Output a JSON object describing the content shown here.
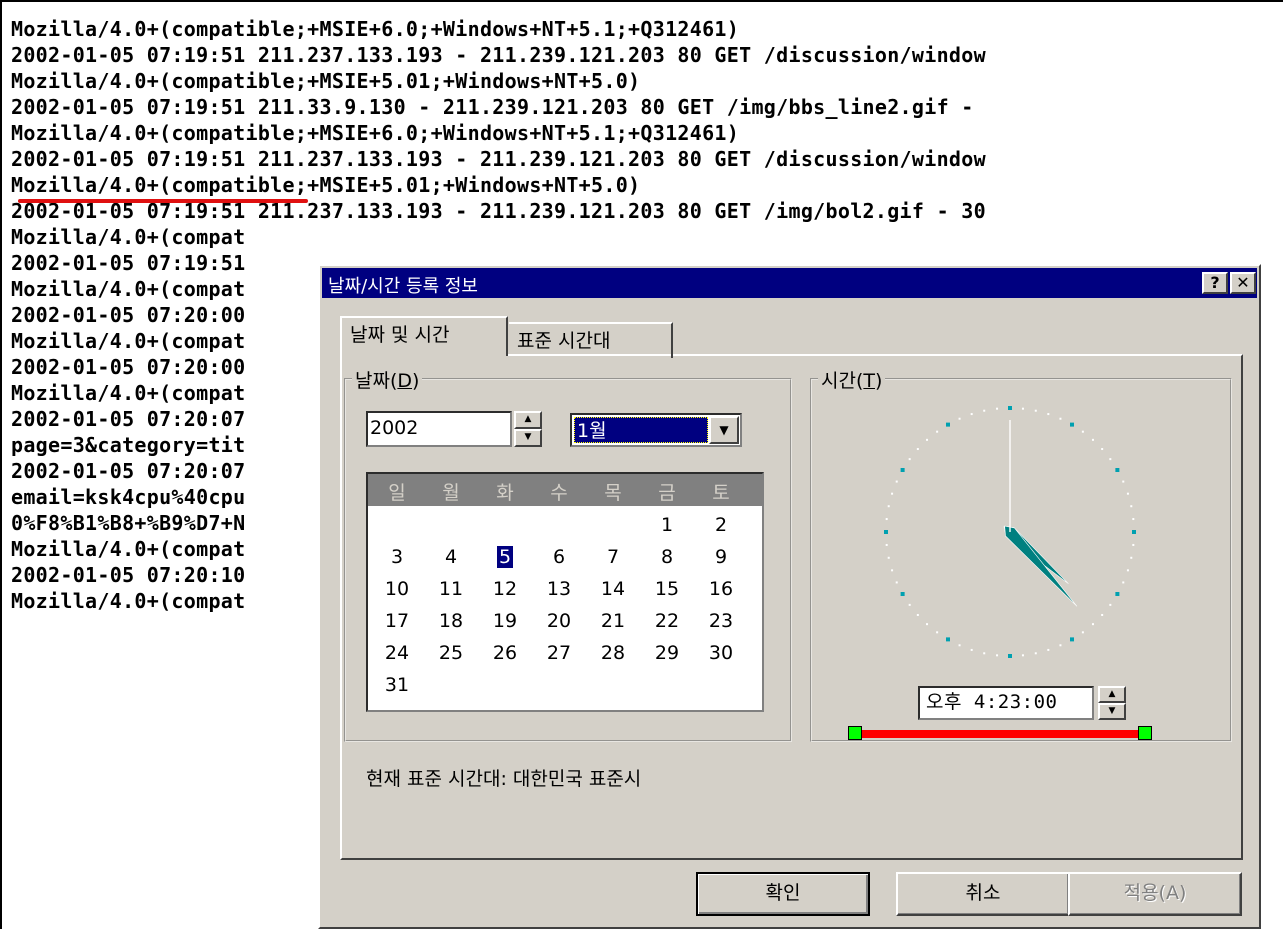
{
  "log": {
    "lines": [
      "Mozilla/4.0+(compatible;+MSIE+6.0;+Windows+NT+5.1;+Q312461)",
      "2002-01-05 07:19:51 211.237.133.193 - 211.239.121.203 80 GET /discussion/window",
      "Mozilla/4.0+(compatible;+MSIE+5.01;+Windows+NT+5.0)",
      "2002-01-05 07:19:51 211.33.9.130 - 211.239.121.203 80 GET /img/bbs_line2.gif -",
      "Mozilla/4.0+(compatible;+MSIE+6.0;+Windows+NT+5.1;+Q312461)",
      "2002-01-05 07:19:51 211.237.133.193 - 211.239.121.203 80 GET /discussion/window",
      "Mozilla/4.0+(compatible;+MSIE+5.01;+Windows+NT+5.0)",
      "2002-01-05 07:19:51 211.237.133.193 - 211.239.121.203 80 GET /img/bol2.gif - 30",
      "Mozilla/4.0+(compat",
      "2002-01-05 07:19:51",
      "Mozilla/4.0+(compat",
      "2002-01-05 07:20:00",
      "Mozilla/4.0+(compat",
      "2002-01-05 07:20:00",
      "Mozilla/4.0+(compat",
      "2002-01-05 07:20:07",
      "page=3&category=tit",
      "2002-01-05 07:20:07",
      "email=ksk4cpu%40cpu",
      "0%F8%B1%B8+%B9%D7+N",
      "Mozilla/4.0+(compat",
      "2002-01-05 07:20:10",
      "Mozilla/4.0+(compat"
    ]
  },
  "dialog": {
    "title": "날짜/시간 등록 정보",
    "help_label": "?",
    "close_label": "✕",
    "tabs": [
      "날짜 및 시간",
      "표준 시간대"
    ],
    "date_group_label": "날짜(D)",
    "time_group_label": "시간(T)",
    "year": "2002",
    "month": "1월",
    "weekdays": [
      "일",
      "월",
      "화",
      "수",
      "목",
      "금",
      "토"
    ],
    "days": [
      "1",
      "2",
      "3",
      "4",
      "5",
      "6",
      "7",
      "8",
      "9",
      "10",
      "11",
      "12",
      "13",
      "14",
      "15",
      "16",
      "17",
      "18",
      "19",
      "20",
      "21",
      "22",
      "23",
      "24",
      "25",
      "26",
      "27",
      "28",
      "29",
      "30",
      "31"
    ],
    "first_weekday_index": 5,
    "selected_day": 5,
    "time": "오후 4:23:00",
    "clock": {
      "hour": 16,
      "minute": 23,
      "second": 0
    },
    "current_timezone": "현재 표준 시간대: 대한민국 표준시",
    "buttons": {
      "ok": "확인",
      "cancel": "취소",
      "apply": "적용(A)"
    },
    "colors": {
      "titlebar": "#000080",
      "face": "#d4d0c8",
      "hands": "#008080",
      "annotation": "#ff0000",
      "handle": "#00ff00"
    }
  }
}
